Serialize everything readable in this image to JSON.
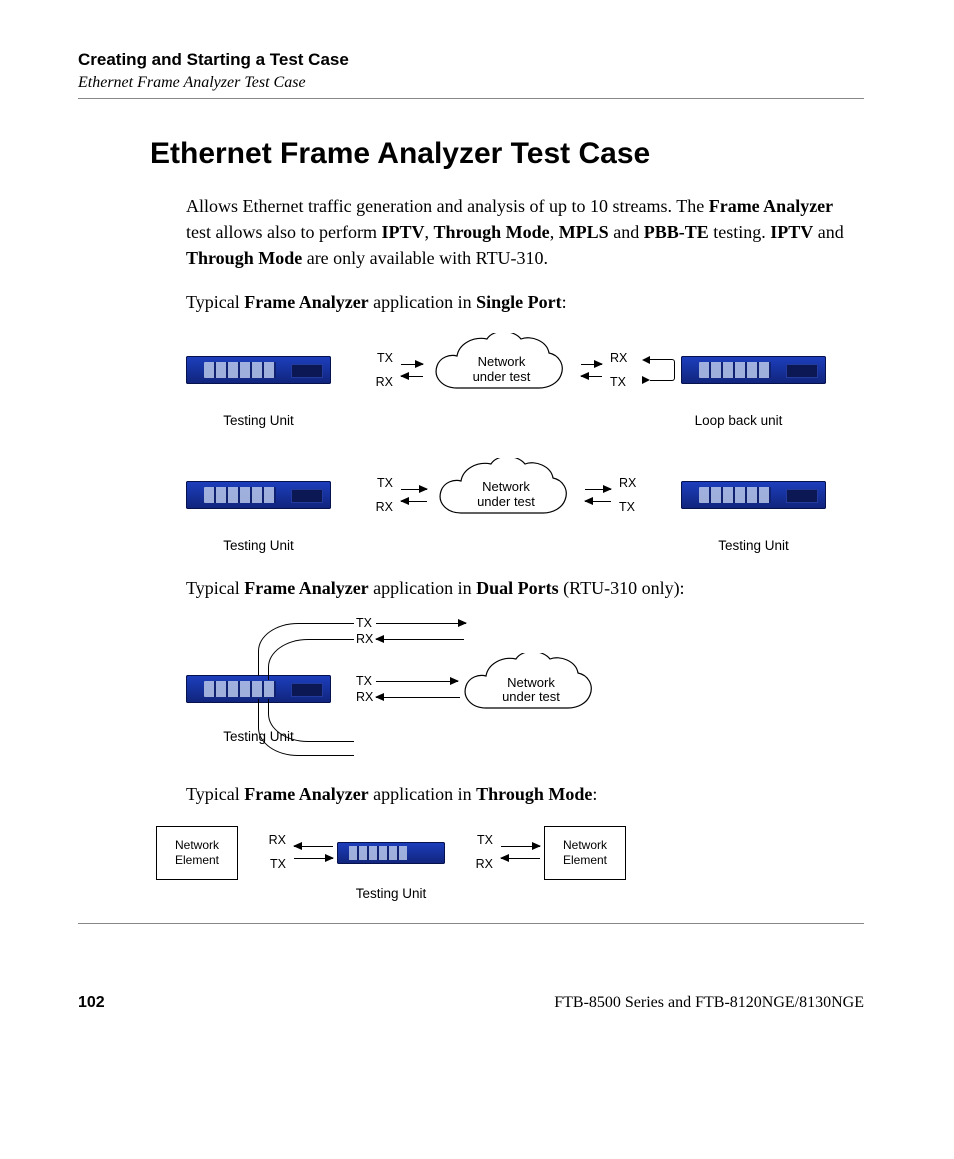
{
  "header": {
    "chapter": "Creating and Starting a Test Case",
    "section": "Ethernet Frame Analyzer Test Case"
  },
  "title": "Ethernet Frame Analyzer Test Case",
  "intro": {
    "pre": "Allows Ethernet traffic generation and analysis of up to 10 streams. The ",
    "b1": "Frame Analyzer",
    "m1": " test allows also to perform ",
    "b2": "IPTV",
    "m2": ", ",
    "b3": "Through Mode",
    "m3": ", ",
    "b4": "MPLS",
    "m4": " and ",
    "b5": "PBB-TE",
    "m5": " testing. ",
    "b6": "IPTV",
    "m6": " and ",
    "b7": "Through Mode",
    "m7": " are only available with RTU-310."
  },
  "para_single": {
    "pre": "Typical ",
    "b1": "Frame Analyzer",
    "m1": " application in ",
    "b2": "Single Port",
    "post": ":"
  },
  "para_dual": {
    "pre": "Typical ",
    "b1": "Frame Analyzer",
    "m1": " application in ",
    "b2": "Dual Ports",
    "post": " (RTU-310 only):"
  },
  "para_through": {
    "pre": "Typical ",
    "b1": "Frame Analyzer",
    "m1": " application in ",
    "b2": "Through Mode",
    "post": ":"
  },
  "labels": {
    "tx": "TX",
    "rx": "RX",
    "testing_unit": "Testing Unit",
    "loopback_unit": "Loop back unit",
    "network_under_test_l1": "Network",
    "network_under_test_l2": "under test",
    "network_element_l1": "Network",
    "network_element_l2": "Element"
  },
  "footer": {
    "page": "102",
    "doc": "FTB-8500 Series and FTB-8120NGE/8130NGE"
  }
}
